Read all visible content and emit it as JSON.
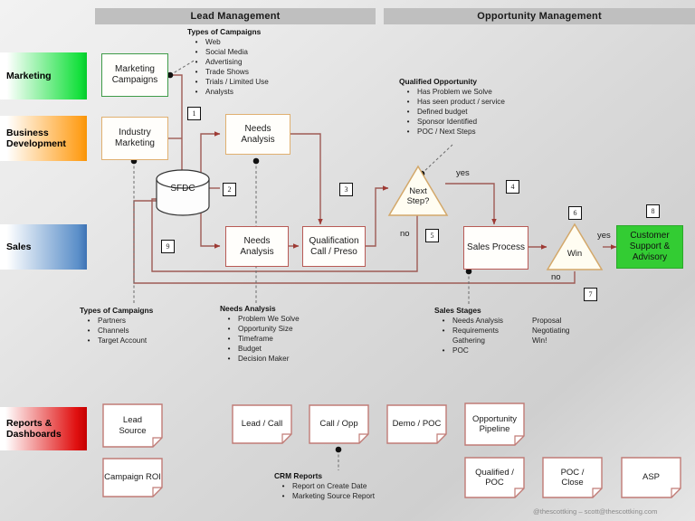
{
  "phases": [
    {
      "id": "lead-management",
      "label": "Lead Management"
    },
    {
      "id": "opportunity-management",
      "label": "Opportunity Management"
    }
  ],
  "roles": [
    {
      "id": "marketing",
      "label": "Marketing",
      "color": "#14e03c"
    },
    {
      "id": "business-development",
      "label": "Business\nDevelopment",
      "line1": "Business",
      "line2": "Development",
      "color": "#ffa01e"
    },
    {
      "id": "sales",
      "label": "Sales",
      "color": "#5b8fc9"
    },
    {
      "id": "reports-dashboards",
      "label": "Reports &\nDashboards",
      "line1": "Reports &",
      "line2": "Dashboards",
      "color": "#e01010"
    }
  ],
  "nodes": {
    "marketing_campaigns": {
      "line1": "Marketing",
      "line2": "Campaigns"
    },
    "industry_marketing": {
      "line1": "Industry",
      "line2": "Marketing"
    },
    "sfdc": {
      "label": "SFDC"
    },
    "needs_analysis_bd": {
      "line1": "Needs",
      "line2": "Analysis"
    },
    "needs_analysis_sales": {
      "line1": "Needs",
      "line2": "Analysis"
    },
    "qualification_call": {
      "line1": "Qualification",
      "line2": "Call / Preso"
    },
    "next_step": {
      "line1": "Next",
      "line2": "Step?"
    },
    "sales_process": {
      "label": "Sales Process"
    },
    "win": {
      "label": "Win"
    },
    "customer_support": {
      "line1": "Customer",
      "line2": "Support &",
      "line3": "Advisory"
    }
  },
  "badges": [
    "1",
    "2",
    "3",
    "4",
    "5",
    "6",
    "7",
    "8",
    "9"
  ],
  "edge_labels": {
    "next_step_yes": "yes",
    "next_step_no": "no",
    "win_yes": "yes",
    "win_no": "no"
  },
  "annotations": {
    "types_of_campaigns_top": {
      "title": "Types of Campaigns",
      "items": [
        "Web",
        "Social Media",
        "Advertising",
        "Trade Shows",
        "Trials / Limited Use",
        "Analysts"
      ]
    },
    "qualified_opportunity": {
      "title": "Qualified Opportunity",
      "items": [
        "Has Problem we Solve",
        "Has seen product / service",
        "Defined budget",
        "Sponsor Identified",
        "POC / Next Steps"
      ]
    },
    "types_of_campaigns_bottom": {
      "title": "Types of Campaigns",
      "items": [
        "Partners",
        "Channels",
        "Target Account"
      ]
    },
    "needs_analysis": {
      "title": "Needs Analysis",
      "items": [
        "Problem We Solve",
        "Opportunity Size",
        "Timeframe",
        "Budget",
        "Decision Maker"
      ]
    },
    "sales_stages": {
      "title": "Sales Stages",
      "col1": [
        "Needs Analysis",
        "Requirements Gathering",
        "POC"
      ],
      "col2": [
        "Proposal",
        "Negotiating",
        "Win!"
      ]
    },
    "crm_reports": {
      "title": "CRM Reports",
      "items": [
        "Report on Create Date",
        "Marketing Source Report"
      ]
    }
  },
  "reports": [
    {
      "id": "lead-source",
      "line1": "Lead",
      "line2": "Source"
    },
    {
      "id": "campaign-roi",
      "line1": "Campaign ROI",
      "line2": ""
    },
    {
      "id": "lead-call",
      "line1": "Lead / Call",
      "line2": ""
    },
    {
      "id": "call-opp",
      "line1": "Call / Opp",
      "line2": ""
    },
    {
      "id": "demo-poc",
      "line1": "Demo / POC",
      "line2": ""
    },
    {
      "id": "opportunity-pipeline",
      "line1": "Opportunity",
      "line2": "Pipeline"
    },
    {
      "id": "qualified-poc",
      "line1": "Qualified /",
      "line2": "POC"
    },
    {
      "id": "poc-close",
      "line1": "POC /",
      "line2": "Close"
    },
    {
      "id": "asp",
      "line1": "ASP",
      "line2": ""
    }
  ],
  "footer": {
    "text": "@thescottking – scott@thescottking.com"
  },
  "colors": {
    "connector": "#9e5b55",
    "phase_band": "#bfbfbf",
    "green_node": "#33cc33",
    "doc_border": "#c07b76"
  }
}
